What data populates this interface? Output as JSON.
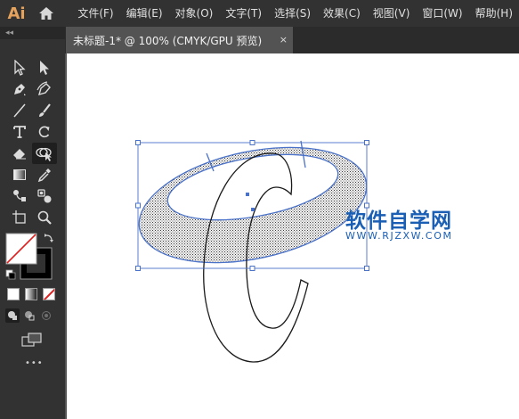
{
  "app": {
    "logo_text": "Ai"
  },
  "menubar": {
    "items": [
      "文件(F)",
      "编辑(E)",
      "对象(O)",
      "文字(T)",
      "选择(S)",
      "效果(C)",
      "视图(V)",
      "窗口(W)",
      "帮助(H)"
    ]
  },
  "toolbar": {
    "collapse_label": "◂◂",
    "more_label": "•••",
    "tools": [
      [
        "selection-tool-icon",
        "direct-selection-tool-icon"
      ],
      [
        "pen-tool-icon",
        "curvature-tool-icon"
      ],
      [
        "line-segment-tool-icon",
        "paintbrush-tool-icon"
      ],
      [
        "type-tool-icon",
        "rotate-tool-icon"
      ],
      [
        "eraser-tool-icon",
        "shape-builder-tool-icon"
      ],
      [
        "gradient-tool-icon",
        "eyedropper-tool-icon"
      ],
      [
        "blend-tool-icon",
        "symbol-sprayer-tool-icon"
      ],
      [
        "artboard-tool-icon",
        "zoom-tool-icon"
      ]
    ],
    "active_tool": "shape-builder-tool-icon",
    "fill_color": "#ffffff",
    "stroke_color": "#000000"
  },
  "document": {
    "tab_title": "未标题-1* @ 100% (CMYK/GPU 预览)",
    "close_glyph": "×"
  },
  "watermark": {
    "title": "软件自学网",
    "url": "WWW.RJZXW.COM"
  },
  "colors": {
    "selection_blue": "#4a72c9",
    "watermark_blue": "#1a5fb4",
    "canvas": "#ffffff",
    "chrome_dark": "#323232",
    "workspace": "#535353"
  }
}
